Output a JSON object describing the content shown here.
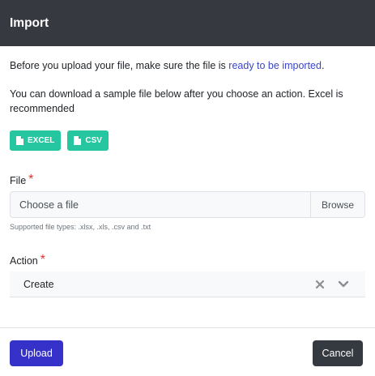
{
  "modal": {
    "title": "Import"
  },
  "intro": {
    "text_before": "Before you upload your file, make sure the file is ",
    "link": "ready to be imported",
    "text_after": "."
  },
  "sample_text": "You can download a sample file below after you choose an action. Excel is recommended",
  "downloads": {
    "excel_label": "EXCEL",
    "csv_label": "CSV"
  },
  "file": {
    "label": "File",
    "required_mark": "*",
    "placeholder": "Choose a file",
    "browse_label": "Browse",
    "help": "Supported file types: .xlsx, .xls, .csv and .txt"
  },
  "action": {
    "label": "Action",
    "required_mark": "*",
    "selected": "Create"
  },
  "footer": {
    "upload_label": "Upload",
    "cancel_label": "Cancel"
  },
  "colors": {
    "header_bg": "#36393f",
    "accent_green": "#26c6a0",
    "primary": "#3531c9",
    "required": "#e3342f"
  }
}
